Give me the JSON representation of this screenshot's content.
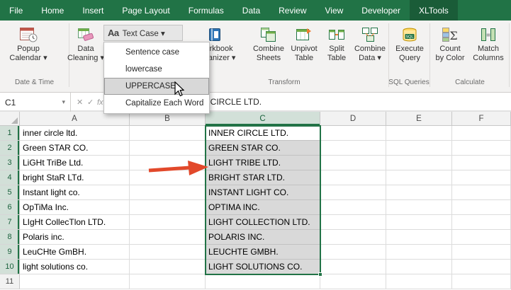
{
  "tabs": {
    "items": [
      "File",
      "Home",
      "Insert",
      "Page Layout",
      "Formulas",
      "Data",
      "Review",
      "View",
      "Developer",
      "XLTools"
    ],
    "active": "XLTools"
  },
  "ribbon": {
    "popup_calendar": {
      "l1": "Popup",
      "l2": "Calendar ▾"
    },
    "data_cleaning": {
      "l1": "Data",
      "l2": "Cleaning ▾"
    },
    "text_case": {
      "icon_text": "Aa",
      "label": "Text Case ▾"
    },
    "workbook_organizer": {
      "l1": "Workbook",
      "l2": "Organizer ▾"
    },
    "combine_sheets": {
      "l1": "Combine",
      "l2": "Sheets"
    },
    "unpivot_table": {
      "l1": "Unpivot",
      "l2": "Table"
    },
    "split_table": {
      "l1": "Split",
      "l2": "Table"
    },
    "combine_data": {
      "l1": "Combine",
      "l2": "Data ▾"
    },
    "execute_query": {
      "l1": "Execute",
      "l2": "Query"
    },
    "count_by_color": {
      "l1": "Count",
      "l2": "by Color"
    },
    "match_columns": {
      "l1": "Match",
      "l2": "Columns"
    },
    "groups": {
      "date_time": "Date & Time",
      "transform": "Transform",
      "sql": "SQL Queries",
      "calculate": "Calculate"
    }
  },
  "menu": {
    "items": [
      "Sentence case",
      "lowercase",
      "UPPERCASE",
      "Capitalize Each Word"
    ],
    "highlighted": "UPPERCASE"
  },
  "formula_bar": {
    "name_box": "C1",
    "namebox_caret": "▾",
    "cancel_icon": "✕",
    "check_icon": "✓",
    "fx_icon": "fx",
    "value": "INNER CIRCLE LTD."
  },
  "grid": {
    "columns": [
      "A",
      "B",
      "C",
      "D",
      "E",
      "F"
    ],
    "selected_range": "C1:C10",
    "rows": [
      {
        "n": "1",
        "a": "inner circle ltd.",
        "c": "INNER CIRCLE LTD."
      },
      {
        "n": "2",
        "a": "Green STAR CO.",
        "c": "GREEN STAR CO."
      },
      {
        "n": "3",
        "a": "LiGHt TriBe Ltd.",
        "c": "LIGHT TRIBE LTD."
      },
      {
        "n": "4",
        "a": "bright StaR LTd.",
        "c": "BRIGHT STAR LTD."
      },
      {
        "n": "5",
        "a": "Instant light co.",
        "c": "INSTANT LIGHT CO."
      },
      {
        "n": "6",
        "a": "OpTiMa Inc.",
        "c": "OPTIMA INC."
      },
      {
        "n": "7",
        "a": "LIgHt CollecTlon LTD.",
        "c": "LIGHT COLLECTION LTD."
      },
      {
        "n": "8",
        "a": "Polaris inc.",
        "c": "POLARIS INC."
      },
      {
        "n": "9",
        "a": "LeuCHte GmBH.",
        "c": "LEUCHTE GMBH."
      },
      {
        "n": "10",
        "a": "light solutions co.",
        "c": "LIGHT SOLUTIONS CO."
      },
      {
        "n": "11",
        "a": "",
        "c": ""
      }
    ]
  },
  "colors": {
    "excel_green": "#217346",
    "selection_fill": "#d9d9d9",
    "annotation_arrow_red": "#e2492b"
  }
}
